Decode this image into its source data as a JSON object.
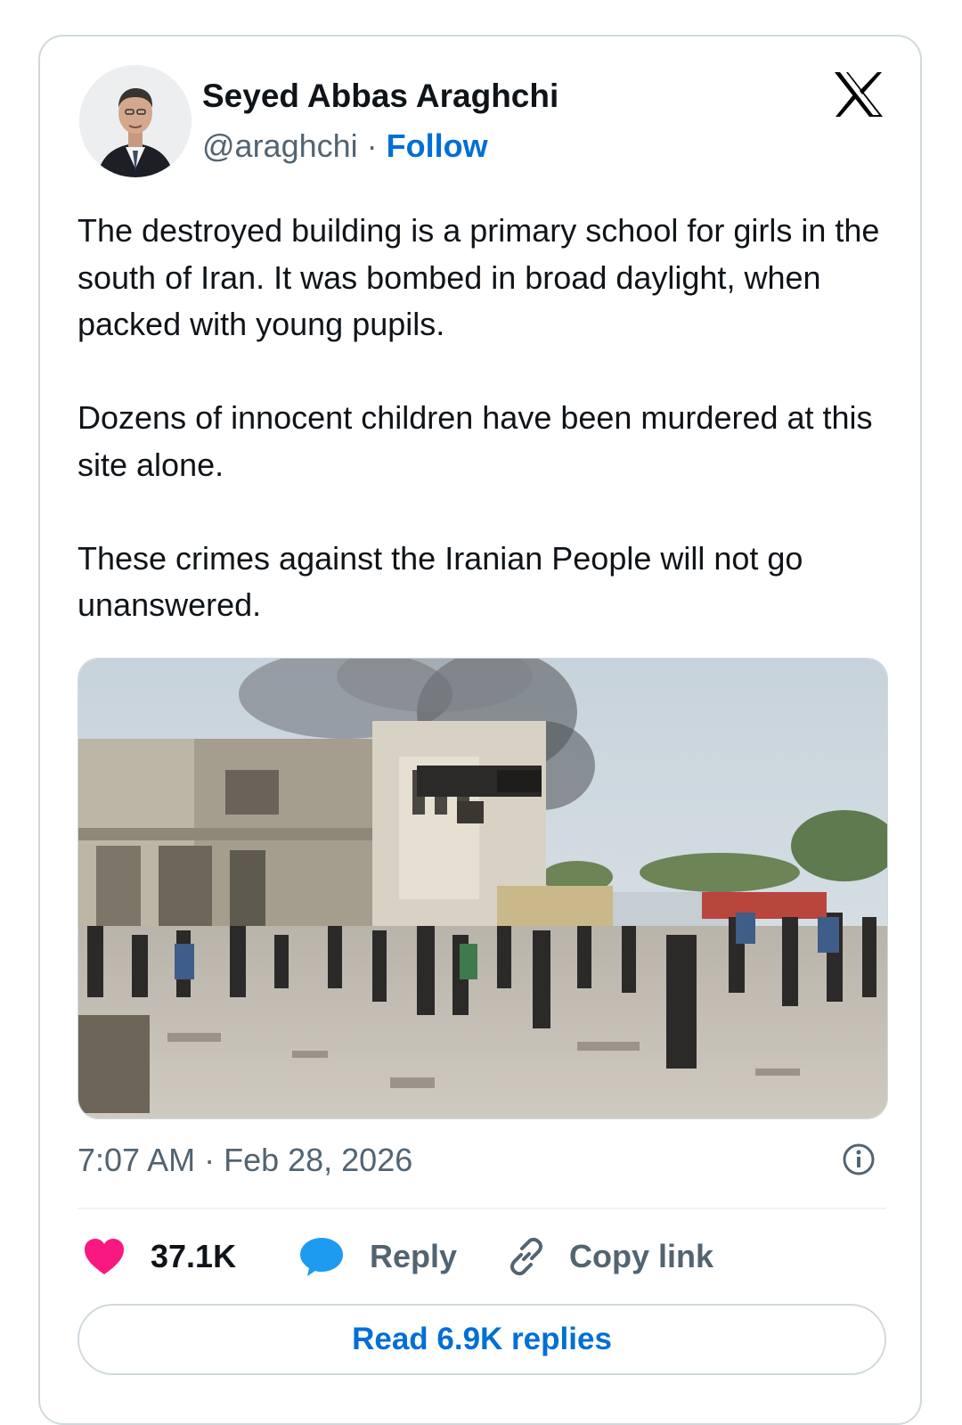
{
  "author": {
    "name": "Seyed Abbas Araghchi",
    "handle": "@araghchi",
    "separator": "·",
    "follow_label": "Follow"
  },
  "tweet": {
    "paragraphs": [
      "The destroyed building is a primary school for girls in the south of Iran. It was bombed in broad daylight, when packed with young pupils.",
      "Dozens of innocent children have been murdered at this site alone.",
      "These crimes against the Iranian People will not go unanswered."
    ],
    "timestamp": "7:07 AM · Feb 28, 2026"
  },
  "actions": {
    "likes_count": "37.1K",
    "reply_label": "Reply",
    "copy_link_label": "Copy link",
    "read_replies_label": "Read 6.9K replies"
  },
  "icons": {
    "brand": "x-logo-icon",
    "info": "info-icon",
    "like": "heart-icon",
    "reply": "speech-bubble-icon",
    "link": "link-icon"
  },
  "colors": {
    "link_blue": "#006fd6",
    "like_pink": "#f91880",
    "reply_blue": "#1d9bf0",
    "secondary_text": "#536471",
    "border": "#cfd9de"
  }
}
